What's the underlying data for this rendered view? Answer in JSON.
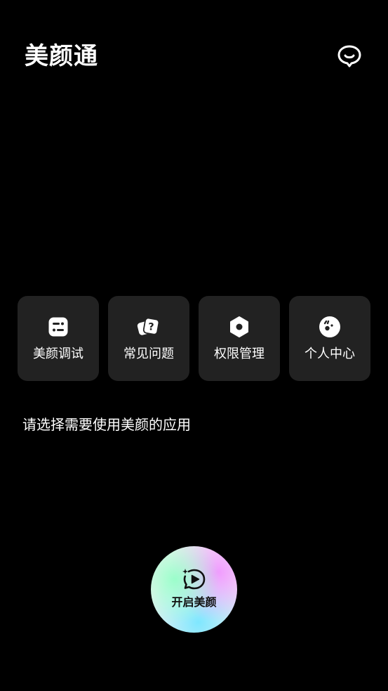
{
  "header": {
    "title": "美颜通",
    "chat_icon": "message-bubble-icon"
  },
  "tiles": [
    {
      "label": "美颜调试",
      "icon": "sliders-icon"
    },
    {
      "label": "常见问题",
      "icon": "question-cards-icon"
    },
    {
      "label": "权限管理",
      "icon": "hexagon-settings-icon"
    },
    {
      "label": "个人中心",
      "icon": "profile-face-icon"
    }
  ],
  "main": {
    "prompt": "请选择需要使用美颜的应用"
  },
  "start_button": {
    "label": "开启美颜",
    "icon": "sparkle-play-icon"
  },
  "colors": {
    "background": "#000000",
    "tile_background": "#222222",
    "text": "#ffffff",
    "button_text": "#111111"
  }
}
